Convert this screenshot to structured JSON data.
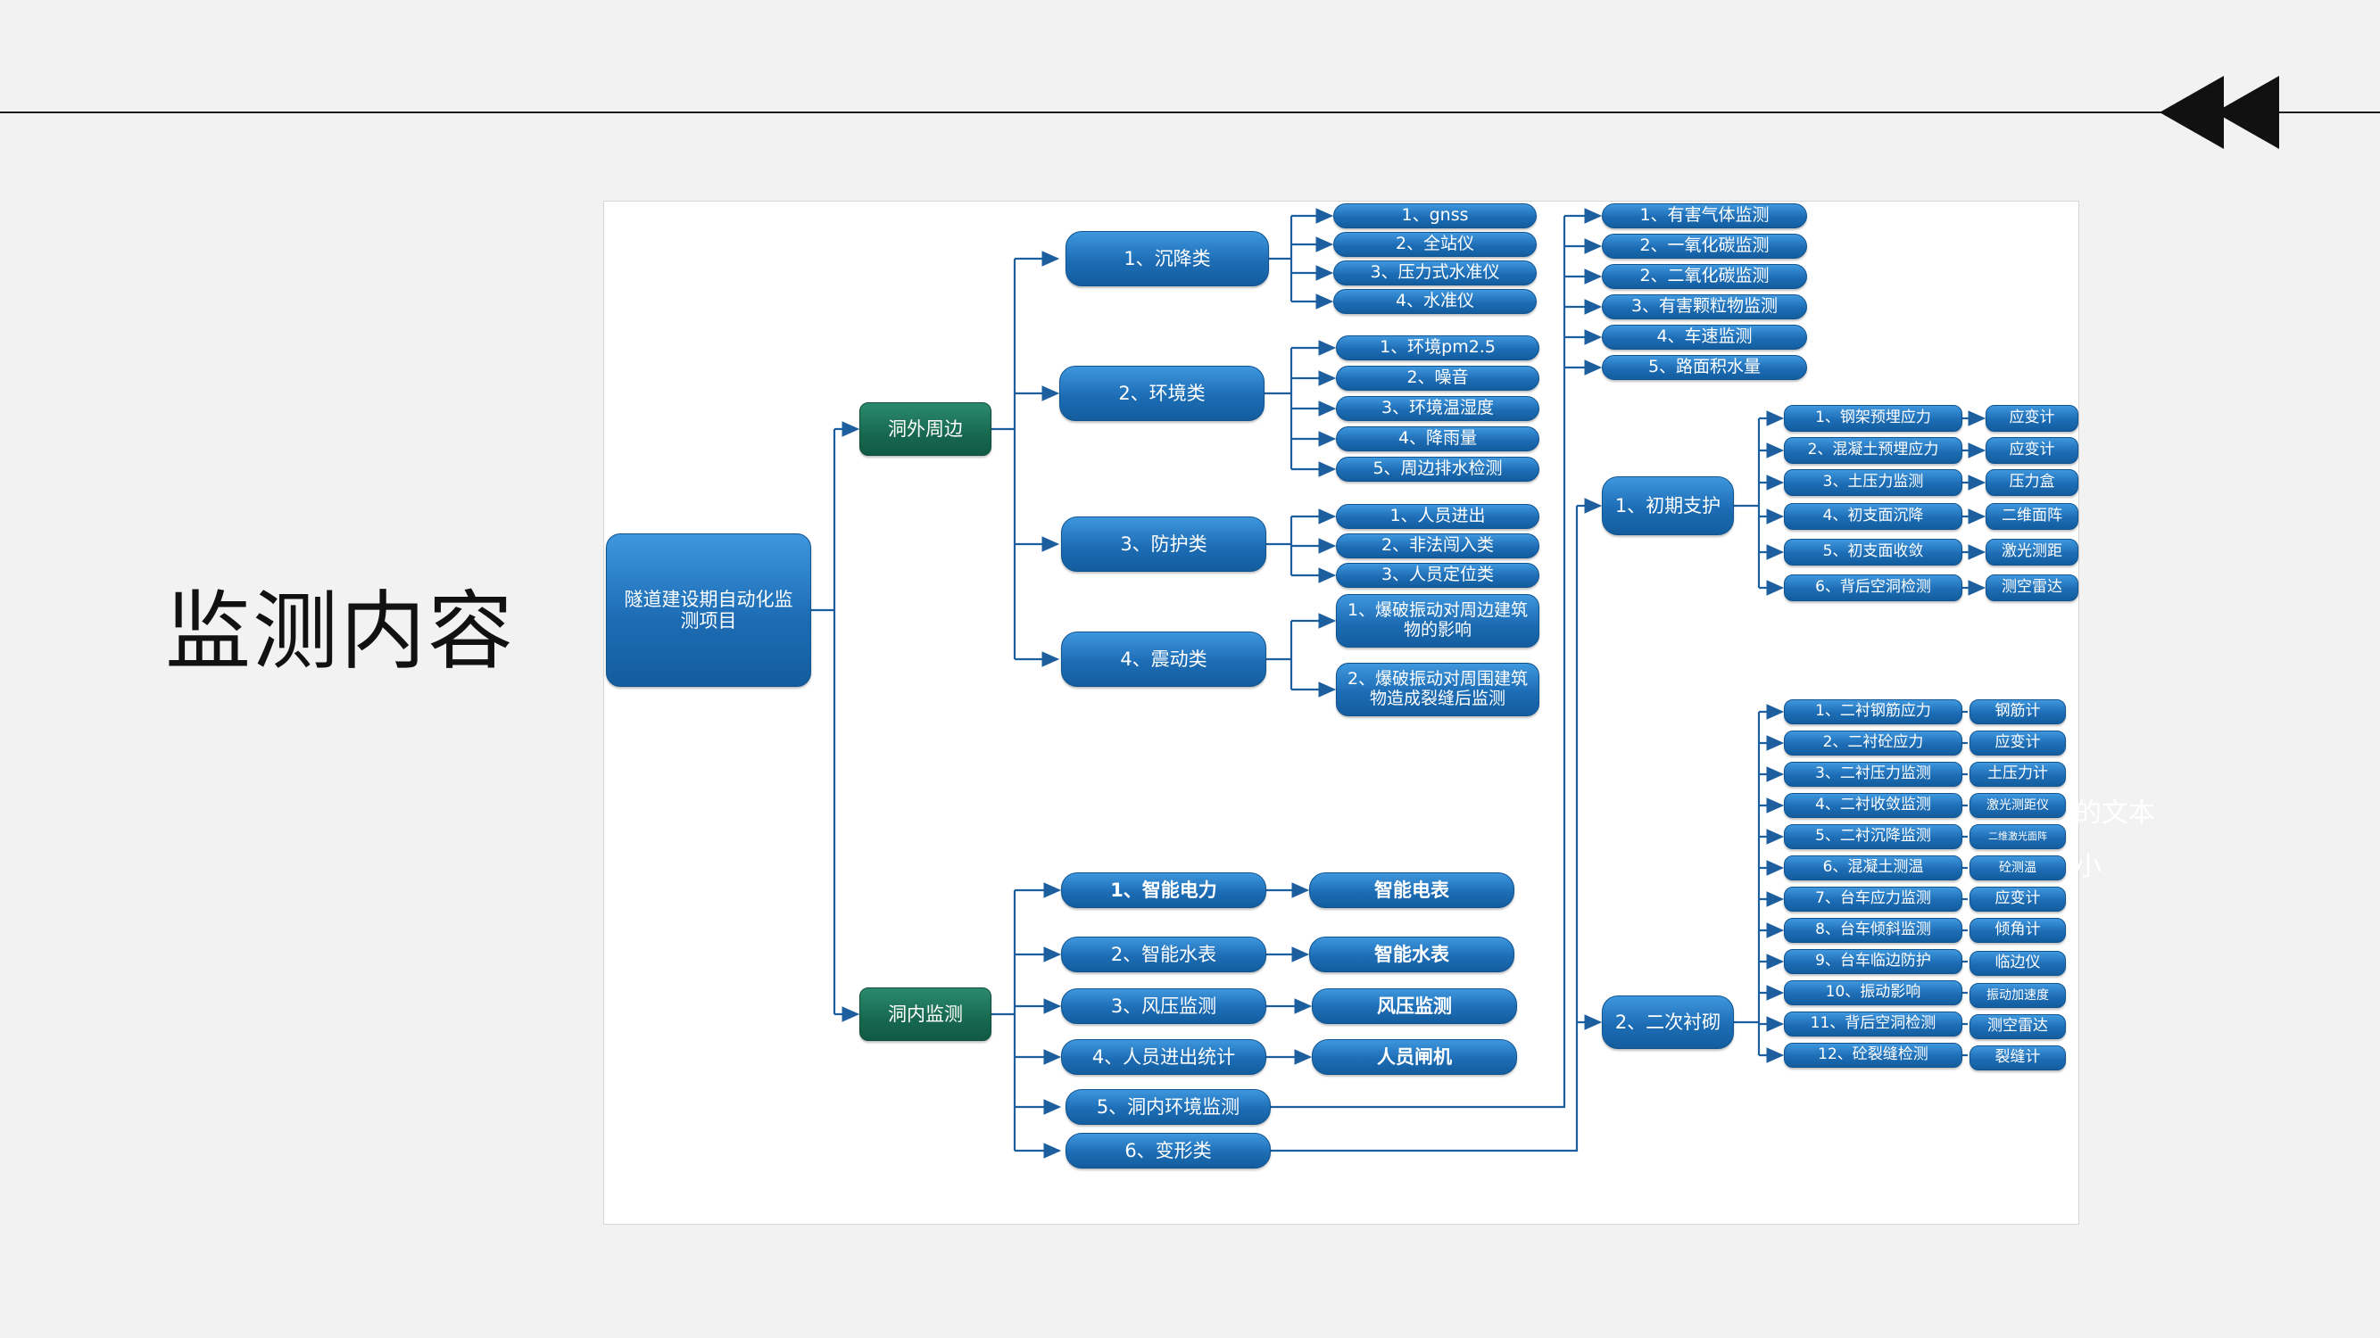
{
  "slide": {
    "title": "监测内容",
    "ghost_text": [
      "的文本",
      "小"
    ]
  },
  "colors": {
    "node_blue": "#1d6db5",
    "node_green": "#17684f",
    "connector": "#1d5f9e",
    "rule": "#1a1a1a"
  },
  "icons": {
    "corner": "rewind-double-triangle"
  },
  "diagram": {
    "root": "隧道建设期自动化监测项目",
    "outside": {
      "label": "洞外周边",
      "settlement": {
        "label": "1、沉降类",
        "items": [
          "1、gnss",
          "2、全站仪",
          "3、压力式水准仪",
          "4、水准仪"
        ]
      },
      "environment": {
        "label": "2、环境类",
        "items": [
          "1、环境pm2.5",
          "2、噪音",
          "3、环境温湿度",
          "4、降雨量",
          "5、周边排水检测"
        ]
      },
      "protection": {
        "label": "3、防护类",
        "items": [
          "1、人员进出",
          "2、非法闯入类",
          "3、人员定位类"
        ]
      },
      "vibration": {
        "label": "4、震动类",
        "items": [
          "1、爆破振动对周边建筑物的影响",
          "2、爆破振动对周围建筑物造成裂缝后监测"
        ]
      }
    },
    "inside": {
      "label": "洞内监测",
      "items": [
        {
          "label": "1、智能电力",
          "target": "智能电表"
        },
        {
          "label": "2、智能水表",
          "target": "智能水表"
        },
        {
          "label": "3、风压监测",
          "target": "风压监测"
        },
        {
          "label": "4、人员进出统计",
          "target": "人员闸机"
        },
        {
          "label": "5、洞内环境监测"
        },
        {
          "label": "6、变形类"
        }
      ],
      "env_items": [
        "1、有害气体监测",
        "2、一氧化碳监测",
        "2、二氧化碳监测",
        "3、有害颗粒物监测",
        "4、车速监测",
        "5、路面积水量"
      ],
      "initial_support": {
        "label": "1、初期支护",
        "items": [
          {
            "label": "1、钢架预埋应力",
            "sensor": "应变计"
          },
          {
            "label": "2、混凝土预埋应力",
            "sensor": "应变计"
          },
          {
            "label": "3、土压力监测",
            "sensor": "压力盒"
          },
          {
            "label": "4、初支面沉降",
            "sensor": "二维面阵"
          },
          {
            "label": "5、初支面收敛",
            "sensor": "激光测距"
          },
          {
            "label": "6、背后空洞检测",
            "sensor": "测空雷达"
          }
        ]
      },
      "secondary_lining": {
        "label": "2、二次衬砌",
        "items": [
          {
            "label": "1、二衬钢筋应力",
            "sensor": "钢筋计"
          },
          {
            "label": "2、二衬砼应力",
            "sensor": "应变计"
          },
          {
            "label": "3、二衬压力监测",
            "sensor": "土压力计"
          },
          {
            "label": "4、二衬收敛监测",
            "sensor": "激光测距仪"
          },
          {
            "label": "5、二衬沉降监测",
            "sensor": "二维激光面阵"
          },
          {
            "label": "6、混凝土测温",
            "sensor": "砼测温"
          },
          {
            "label": "7、台车应力监测",
            "sensor": "应变计"
          },
          {
            "label": "8、台车倾斜监测",
            "sensor": "倾角计"
          },
          {
            "label": "9、台车临边防护",
            "sensor": "临边仪"
          },
          {
            "label": "10、振动影响",
            "sensor": "振动加速度"
          },
          {
            "label": "11、背后空洞检测",
            "sensor": "测空雷达"
          },
          {
            "label": "12、砼裂缝检测",
            "sensor": "裂缝计"
          }
        ]
      }
    }
  }
}
